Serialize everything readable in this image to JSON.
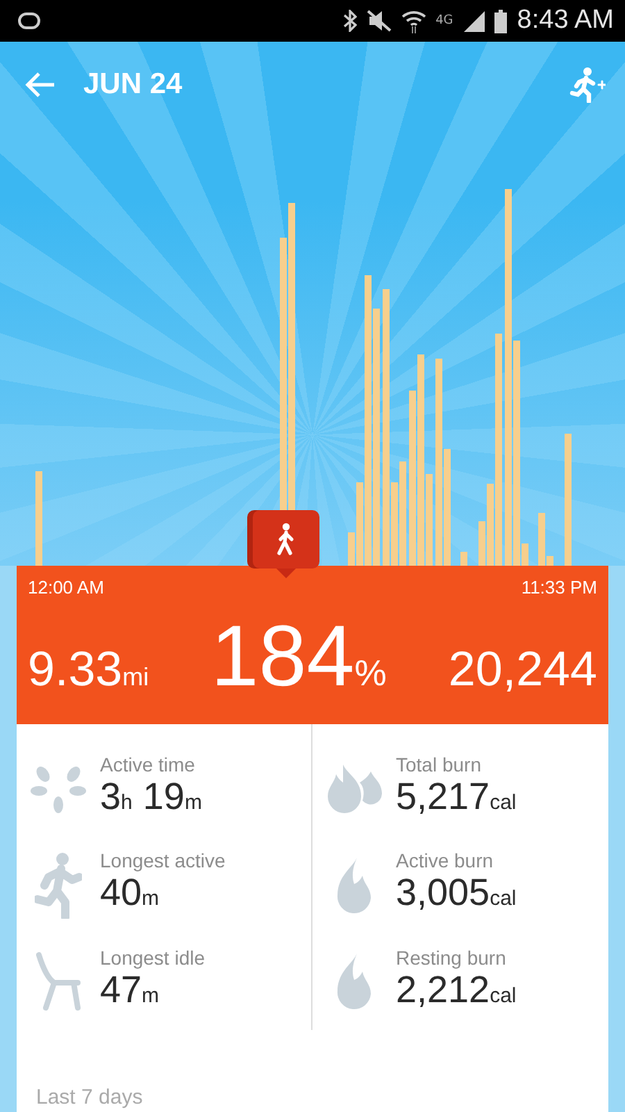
{
  "status_bar": {
    "network": "4G",
    "time": "8:43 AM"
  },
  "header": {
    "date": "JUN 24"
  },
  "summary": {
    "start_time": "12:00 AM",
    "end_time": "11:33 PM",
    "distance": {
      "number": "9.33",
      "unit": "mi"
    },
    "goal": {
      "number": "184",
      "unit": "%"
    },
    "steps": "20,244"
  },
  "stats": {
    "left": [
      {
        "kind": "active",
        "label": "Active time",
        "value": [
          {
            "number": "3",
            "unit": "h"
          },
          {
            "number": "19",
            "unit": "m"
          }
        ]
      },
      {
        "kind": "runner",
        "label": "Longest active",
        "value": [
          {
            "number": "40",
            "unit": "m"
          }
        ]
      },
      {
        "kind": "idle",
        "label": "Longest idle",
        "value": [
          {
            "number": "47",
            "unit": "m"
          }
        ]
      }
    ],
    "right": [
      {
        "kind": "flames",
        "label": "Total burn",
        "value": [
          {
            "number": "5,217",
            "unit": "cal"
          }
        ]
      },
      {
        "kind": "flame",
        "label": "Active burn",
        "value": [
          {
            "number": "3,005",
            "unit": "cal"
          }
        ]
      },
      {
        "kind": "flame",
        "label": "Resting burn",
        "value": [
          {
            "number": "2,212",
            "unit": "cal"
          }
        ]
      }
    ]
  },
  "section": {
    "title": "Last 7 days"
  }
}
